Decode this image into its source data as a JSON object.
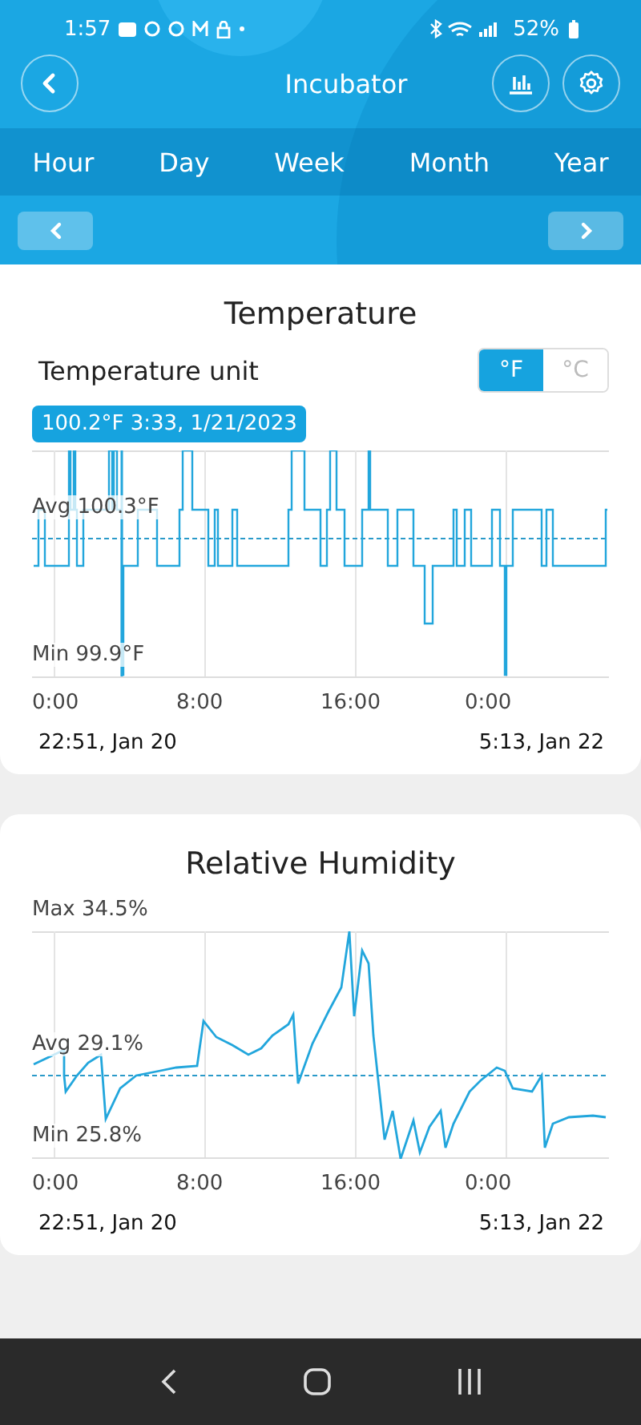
{
  "status_bar": {
    "time": "1:57",
    "battery": "52%"
  },
  "header": {
    "title": "Incubator"
  },
  "tabs": [
    {
      "label": "Hour",
      "selected": false
    },
    {
      "label": "Day",
      "selected": false
    },
    {
      "label": "Week",
      "selected": false
    },
    {
      "label": "Month",
      "selected": false
    },
    {
      "label": "Year",
      "selected": false
    }
  ],
  "cards": [
    {
      "kind": "temperature",
      "title": "Temperature",
      "unit_label": "Temperature unit",
      "units": [
        {
          "label": "°F",
          "selected": true
        },
        {
          "label": "°C",
          "selected": false
        }
      ],
      "tooltip": "100.2°F 3:33,  1/21/2023",
      "avg_label": "Avg 100.3°F",
      "min_label": "Min 99.9°F",
      "x_labels": [
        "0:00",
        "8:00",
        "16:00",
        "0:00"
      ],
      "range_start": "22:51,  Jan 20",
      "range_end": "5:13,  Jan 22"
    },
    {
      "kind": "humidity",
      "title": "Relative Humidity",
      "max_label": "Max 34.5%",
      "avg_label": "Avg 29.1%",
      "min_label": "Min 25.8%",
      "x_labels": [
        "0:00",
        "8:00",
        "16:00",
        "0:00"
      ],
      "range_start": "22:51,  Jan 20",
      "range_end": "5:13,  Jan 22"
    }
  ]
}
